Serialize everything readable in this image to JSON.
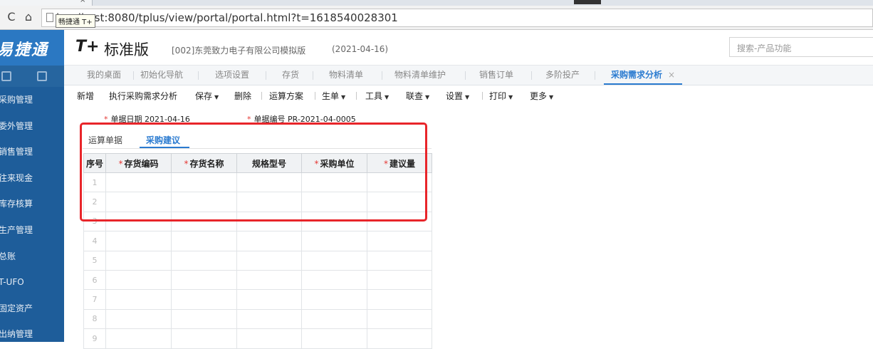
{
  "browser": {
    "tab_title": "畅捷通 T+",
    "tab_close": "×",
    "nav_back_glyph": "C",
    "home_glyph": "⌂",
    "url": "localhost:8080/tplus/view/portal/portal.html?t=1618540028301",
    "tooltip": "畅捷通 T+"
  },
  "app": {
    "brand_text": "易捷通",
    "product_logo": "T+",
    "product_name": "标准版",
    "company": "[002]东莞致力电子有限公司模拟版",
    "account_date": "(2021-04-16)",
    "search_placeholder": "搜索-产品功能"
  },
  "sidebar": {
    "items": [
      {
        "label": "采购管理"
      },
      {
        "label": "委外管理"
      },
      {
        "label": "销售管理"
      },
      {
        "label": "往来现金"
      },
      {
        "label": "库存核算"
      },
      {
        "label": "生产管理"
      },
      {
        "label": "总账"
      },
      {
        "label": "T-UFO"
      },
      {
        "label": "固定资产"
      },
      {
        "label": "出纳管理"
      }
    ]
  },
  "module_tabs": [
    {
      "label": "我的桌面"
    },
    {
      "label": "初始化导航"
    },
    {
      "label": "选项设置"
    },
    {
      "label": "存货"
    },
    {
      "label": "物料清单"
    },
    {
      "label": "物料清单维护"
    },
    {
      "label": "销售订单"
    },
    {
      "label": "多阶投产"
    },
    {
      "label": "采购需求分析",
      "active": true,
      "close": "×"
    }
  ],
  "toolbar": {
    "items": [
      "新增",
      "执行采购需求分析",
      "保存",
      "删除",
      "运算方案",
      "生单",
      "工具",
      "联查",
      "设置",
      "打印",
      "更多"
    ],
    "caret": "▼"
  },
  "form": {
    "required_mark": "*",
    "date_label": "单据日期",
    "date_value": "2021-04-16",
    "number_label": "单据编号",
    "number_value": "PR-2021-04-0005"
  },
  "inner_tabs": [
    {
      "label": "运算单据"
    },
    {
      "label": "采购建议",
      "active": true
    }
  ],
  "grid": {
    "columns": [
      "序号",
      "存货编码",
      "存货名称",
      "规格型号",
      "采购单位",
      "建议量"
    ],
    "required_columns": [
      false,
      true,
      true,
      false,
      true,
      true
    ],
    "rows": [
      "1",
      "2",
      "3",
      "4",
      "5",
      "6",
      "7",
      "8",
      "9"
    ]
  },
  "colors": {
    "brand_blue": "#2b78c2",
    "sidebar_blue": "#1e5d9a",
    "active_tab": "#2b7bd0",
    "annotation_red": "#e8252a"
  }
}
